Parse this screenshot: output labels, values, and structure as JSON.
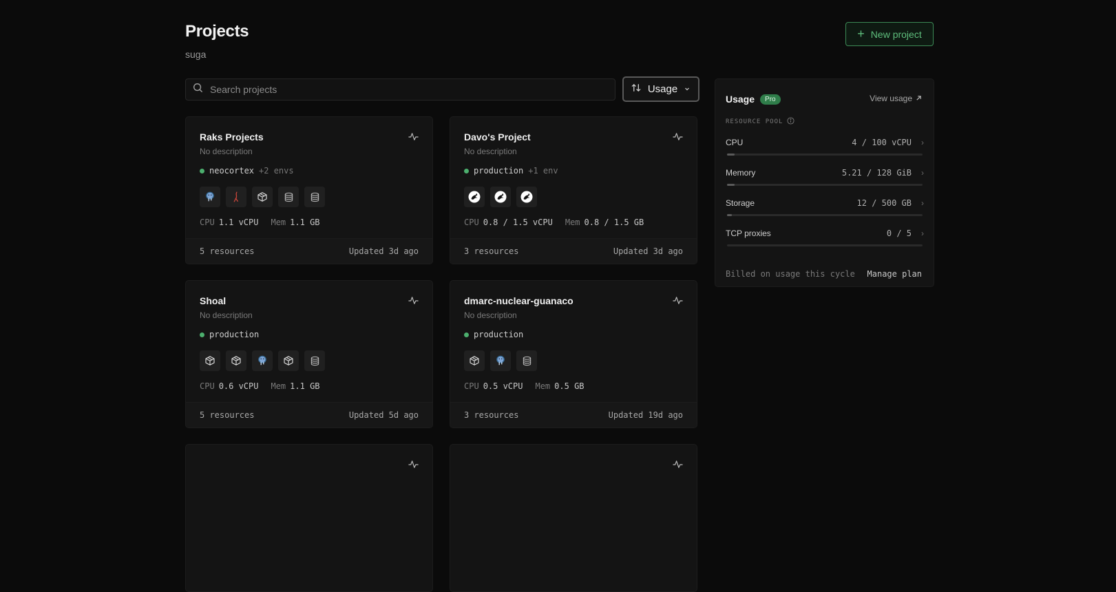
{
  "header": {
    "title": "Projects",
    "workspace": "suga",
    "new_project_label": "New project"
  },
  "toolbar": {
    "search_placeholder": "Search projects",
    "sort_label": "Usage"
  },
  "projects": [
    {
      "name": "Raks Projects",
      "description": "No description",
      "env_name": "neocortex",
      "env_extra": "+2 envs",
      "services": [
        "postgres-icon",
        "redis-icon",
        "cube-icon",
        "database-icon",
        "database-icon"
      ],
      "cpu_label": "CPU",
      "cpu": "1.1 vCPU",
      "mem_label": "Mem",
      "mem": "1.1 GB",
      "resources": "5 resources",
      "updated": "Updated 3d ago"
    },
    {
      "name": "Davo's Project",
      "description": "No description",
      "env_name": "production",
      "env_extra": "+1 env",
      "services": [
        "app-icon",
        "app-icon",
        "app-icon"
      ],
      "cpu_label": "CPU",
      "cpu": "0.8 / 1.5 vCPU",
      "mem_label": "Mem",
      "mem": "0.8 / 1.5 GB",
      "resources": "3 resources",
      "updated": "Updated 3d ago"
    },
    {
      "name": "Shoal",
      "description": "No description",
      "env_name": "production",
      "env_extra": "",
      "services": [
        "cube-icon",
        "cube-icon",
        "postgres-icon",
        "cube-icon",
        "database-icon"
      ],
      "cpu_label": "CPU",
      "cpu": "0.6 vCPU",
      "mem_label": "Mem",
      "mem": "1.1 GB",
      "resources": "5 resources",
      "updated": "Updated 5d ago"
    },
    {
      "name": "dmarc-nuclear-guanaco",
      "description": "No description",
      "env_name": "production",
      "env_extra": "",
      "services": [
        "cube-icon",
        "postgres-icon",
        "database-icon"
      ],
      "cpu_label": "CPU",
      "cpu": "0.5 vCPU",
      "mem_label": "Mem",
      "mem": "0.5 GB",
      "resources": "3 resources",
      "updated": "Updated 19d ago"
    }
  ],
  "usage": {
    "title": "Usage",
    "badge": "Pro",
    "view_label": "View usage",
    "pool_label": "RESOURCE POOL",
    "rows": [
      {
        "label": "CPU",
        "value": "4 / 100 vCPU",
        "fraction": 0.04
      },
      {
        "label": "Memory",
        "value": "5.21 / 128 GiB",
        "fraction": 0.04
      },
      {
        "label": "Storage",
        "value": "12 / 500 GB",
        "fraction": 0.024
      },
      {
        "label": "TCP proxies",
        "value": "0 / 5",
        "fraction": 0
      }
    ],
    "billed_label": "Billed on usage this cycle",
    "manage_label": "Manage plan"
  },
  "colors": {
    "accent": "#5fbf7d",
    "status_ok": "#4caf6e",
    "background": "#0b0b0b",
    "card": "#141414"
  }
}
